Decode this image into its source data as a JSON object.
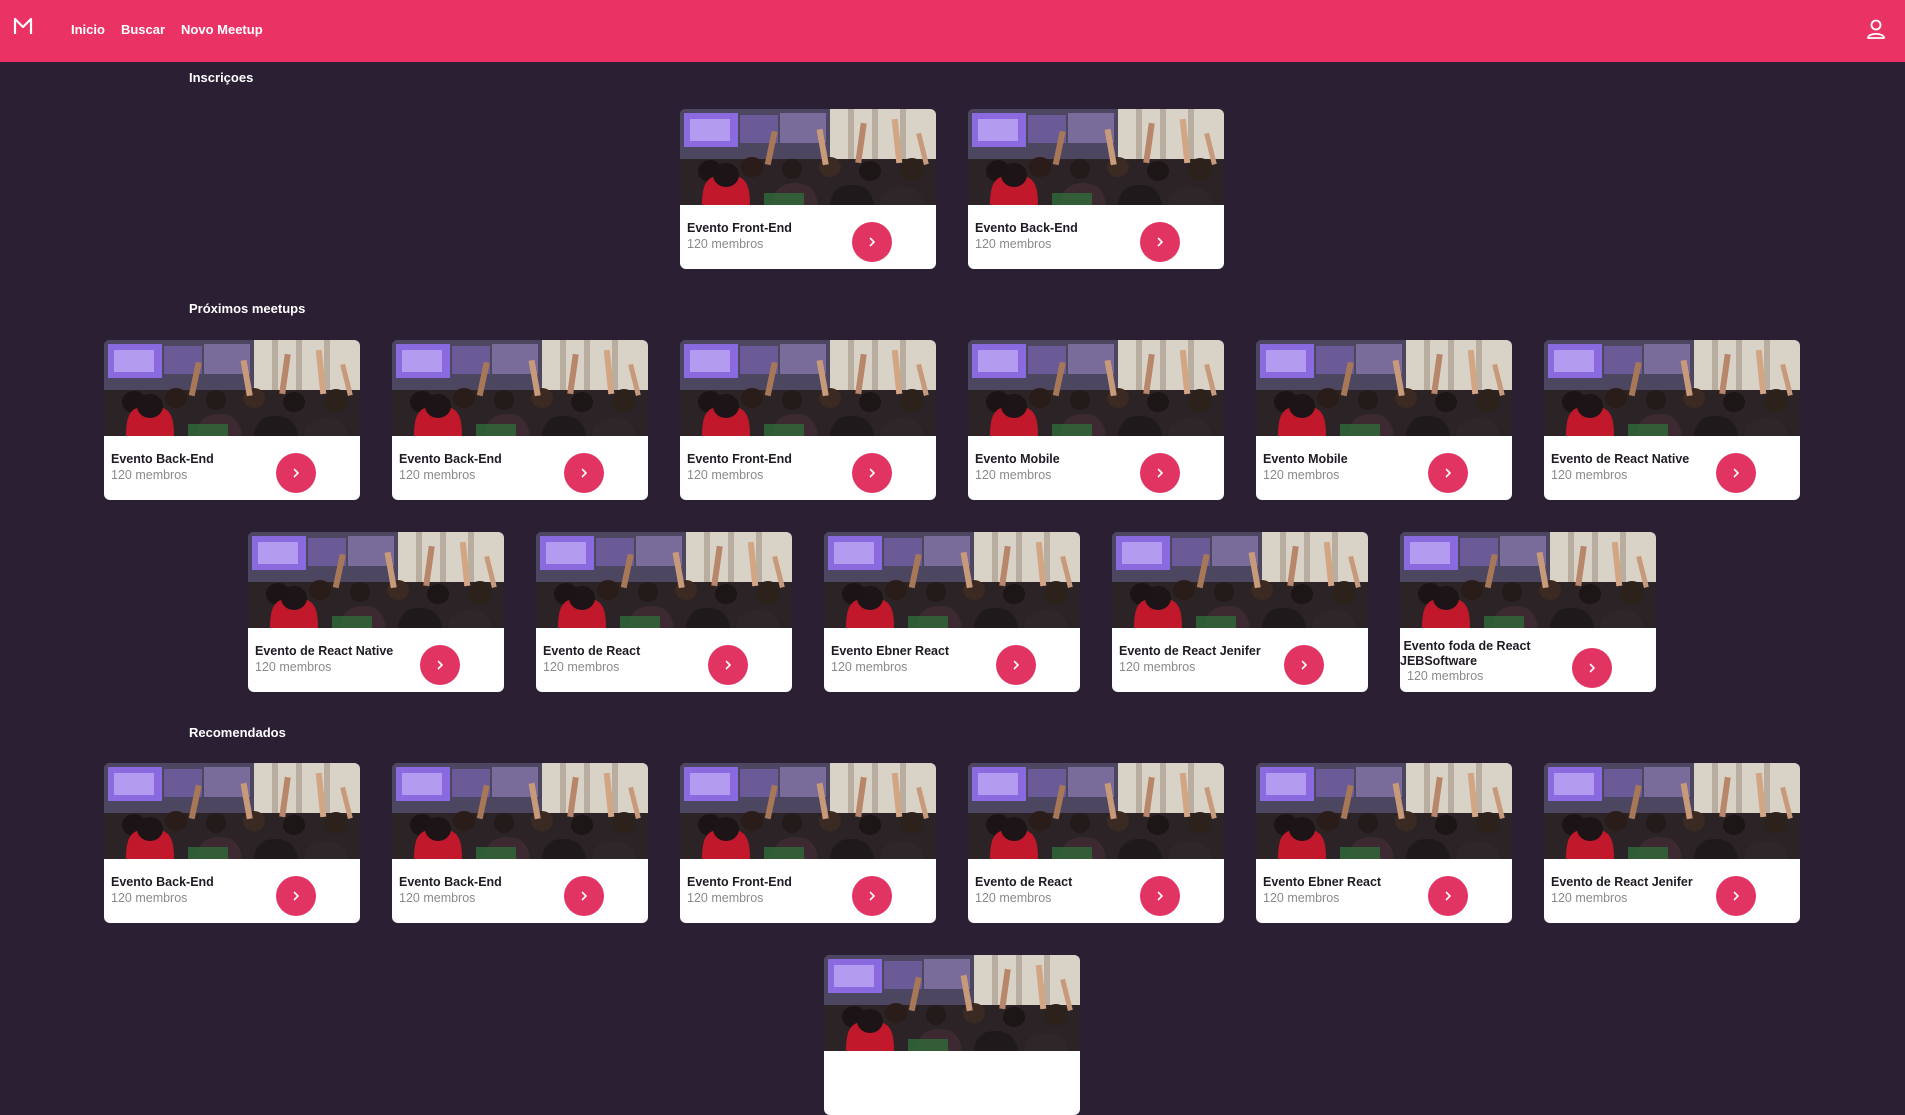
{
  "header": {
    "logo": "M",
    "nav": [
      "Inicio",
      "Buscar",
      "Novo Meetup"
    ],
    "bg_color": "#ea3364"
  },
  "sections": {
    "subscriptions": {
      "title": "Inscriçoes",
      "cards": [
        {
          "title": "Evento Front-End",
          "members": "120 membros"
        },
        {
          "title": "Evento Back-End",
          "members": "120 membros"
        }
      ]
    },
    "upcoming": {
      "title": "Próximos meetups",
      "cards": [
        {
          "title": "Evento Back-End",
          "members": "120 membros"
        },
        {
          "title": "Evento Back-End",
          "members": "120 membros"
        },
        {
          "title": "Evento Front-End",
          "members": "120 membros"
        },
        {
          "title": "Evento Mobile",
          "members": "120 membros"
        },
        {
          "title": "Evento Mobile",
          "members": "120 membros"
        },
        {
          "title": "Evento de React Native",
          "members": "120 membros"
        },
        {
          "title": "Evento de React Native",
          "members": "120 membros"
        },
        {
          "title": "Evento de React",
          "members": "120 membros"
        },
        {
          "title": "Evento Ebner React",
          "members": "120 membros"
        },
        {
          "title": "Evento de React Jenifer",
          "members": "120 membros"
        },
        {
          "title": "Evento foda de React JEBSoftware",
          "members": "120 membros"
        }
      ]
    },
    "recommended": {
      "title": "Recomendados",
      "cards": [
        {
          "title": "Evento Back-End",
          "members": "120 membros"
        },
        {
          "title": "Evento Back-End",
          "members": "120 membros"
        },
        {
          "title": "Evento Front-End",
          "members": "120 membros"
        },
        {
          "title": "Evento de React",
          "members": "120 membros"
        },
        {
          "title": "Evento Ebner React",
          "members": "120 membros"
        },
        {
          "title": "Evento de React Jenifer",
          "members": "120 membros"
        }
      ]
    }
  },
  "icons": {
    "logo": "meetup-logo-icon",
    "user": "user-icon",
    "card_button": "chevron-right-icon"
  },
  "colors": {
    "background": "#2a1f33",
    "accent": "#e23462"
  }
}
